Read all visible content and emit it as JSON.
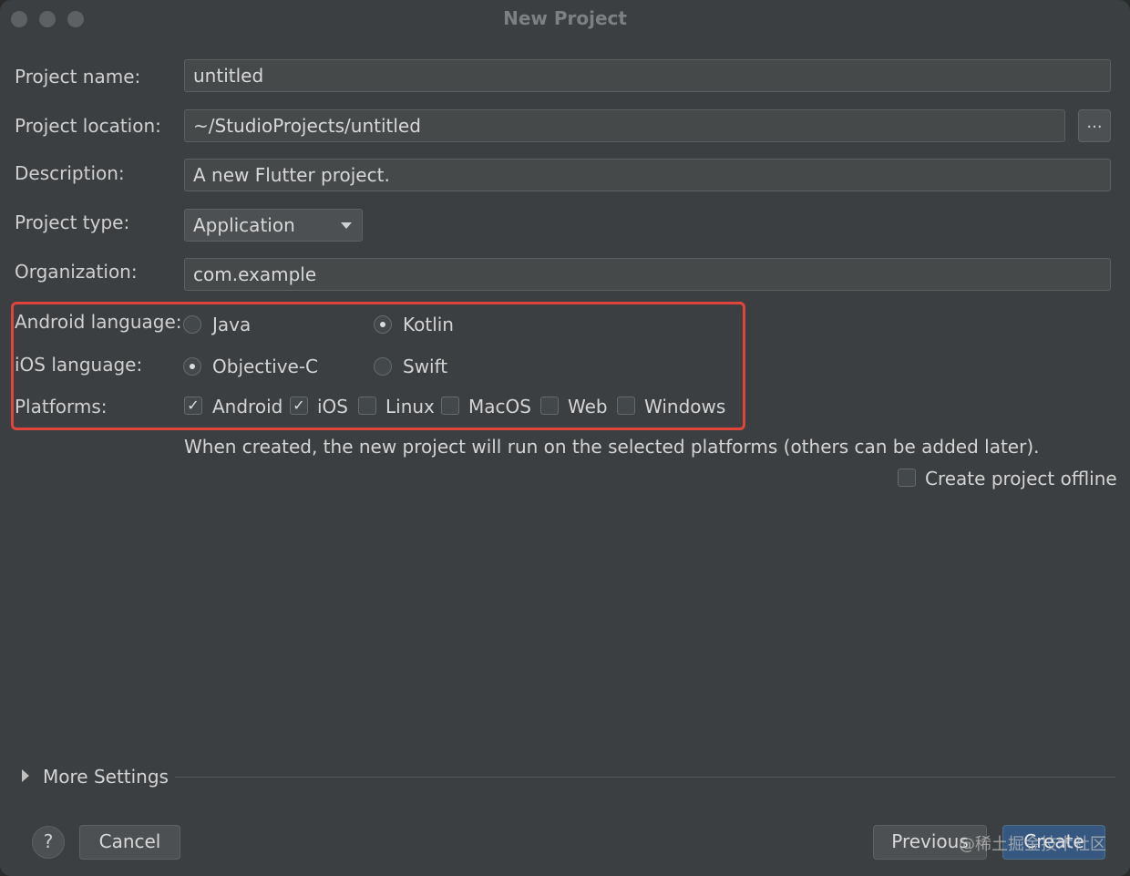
{
  "window": {
    "title": "New Project"
  },
  "form": {
    "project_name": {
      "label": "Project name:",
      "value": "untitled"
    },
    "project_location": {
      "label": "Project location:",
      "value": "~/StudioProjects/untitled",
      "browse_label": "..."
    },
    "description": {
      "label": "Description:",
      "value": "A new Flutter project."
    },
    "project_type": {
      "label": "Project type:",
      "value": "Application"
    },
    "organization": {
      "label": "Organization:",
      "value": "com.example"
    }
  },
  "android_language": {
    "label": "Android language:",
    "options": [
      {
        "label": "Java",
        "selected": false
      },
      {
        "label": "Kotlin",
        "selected": true
      }
    ]
  },
  "ios_language": {
    "label": "iOS language:",
    "options": [
      {
        "label": "Objective-C",
        "selected": true
      },
      {
        "label": "Swift",
        "selected": false
      }
    ]
  },
  "platforms": {
    "label": "Platforms:",
    "items": [
      {
        "label": "Android",
        "checked": true
      },
      {
        "label": "iOS",
        "checked": true
      },
      {
        "label": "Linux",
        "checked": false
      },
      {
        "label": "MacOS",
        "checked": false
      },
      {
        "label": "Web",
        "checked": false
      },
      {
        "label": "Windows",
        "checked": false
      }
    ],
    "hint": "When created, the new project will run on the selected platforms (others can be added later)."
  },
  "offline": {
    "label": "Create project offline",
    "checked": false
  },
  "more_settings": {
    "label": "More Settings"
  },
  "footer": {
    "help_label": "?",
    "cancel_label": "Cancel",
    "previous_label": "Previous",
    "create_label": "Create",
    "watermark": "@稀土掘金技术社区"
  },
  "colors": {
    "window_bg": "#3c3f41",
    "highlight_border": "#e0443a",
    "primary_button": "#365880"
  }
}
